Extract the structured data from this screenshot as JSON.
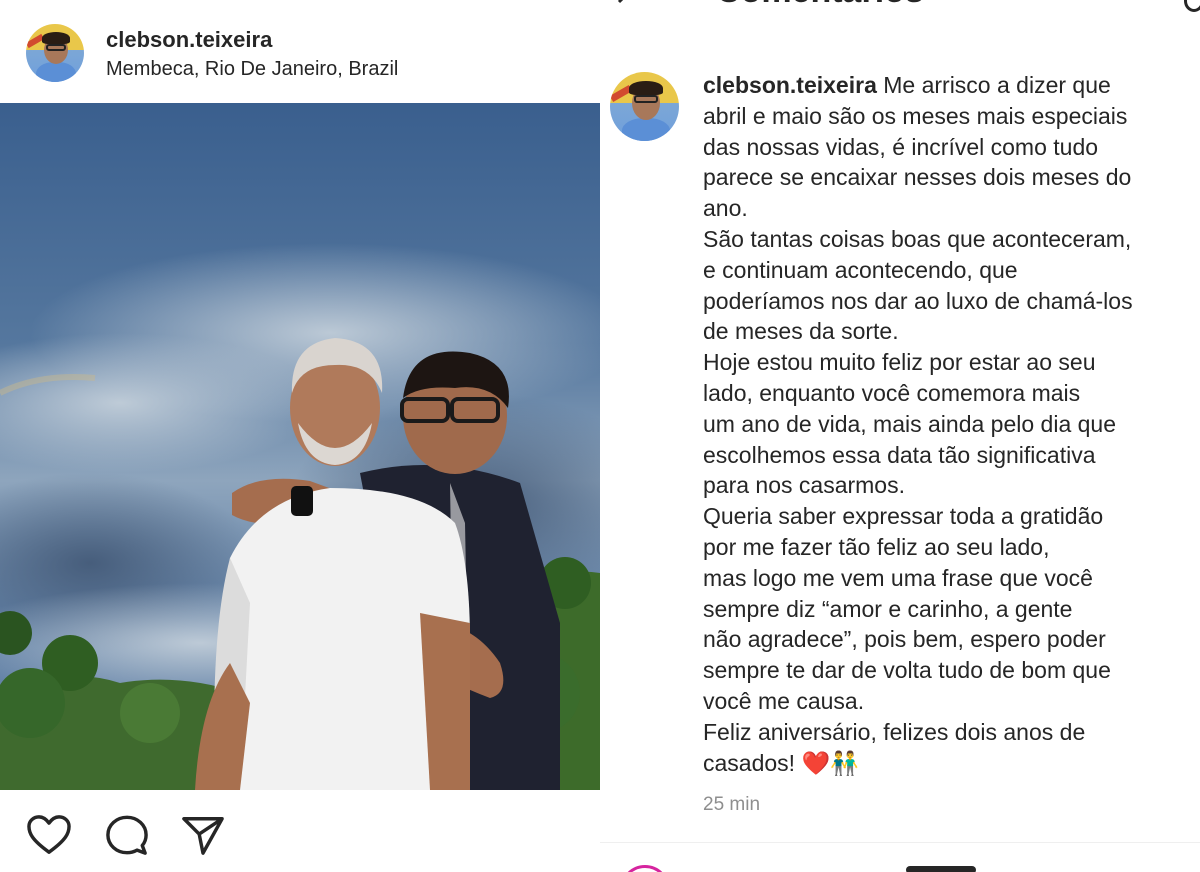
{
  "post": {
    "username": "clebson.teixeira",
    "location": "Membeca, Rio De Janeiro, Brazil"
  },
  "icons": {
    "actions": [
      "heart-icon",
      "comment-icon",
      "share-icon"
    ],
    "back": "arrow-left-icon"
  },
  "comments_panel": {
    "title": "Comentários",
    "comment": {
      "username": "clebson.teixeira",
      "lines": [
        "Me arrisco a dizer que",
        "abril e maio são os meses mais especiais",
        "das nossas vidas, é incrível como tudo",
        "parece se encaixar nesses dois meses do",
        "ano.",
        "São tantas coisas boas que aconteceram,",
        "e continuam acontecendo, que",
        "poderíamos nos dar ao luxo de chamá-los",
        "de meses da sorte.",
        "Hoje estou muito feliz por estar ao seu",
        "lado, enquanto você comemora mais",
        "um ano de vida, mais ainda pelo dia que",
        "escolhemos essa data tão significativa",
        "para nos casarmos.",
        "Queria saber expressar toda a gratidão",
        "por me fazer tão feliz ao seu lado,",
        "mas logo me vem uma frase que você",
        "sempre diz “amor e carinho, a gente",
        "não agradece”, pois bem, espero poder",
        "sempre te dar de volta tudo de bom que",
        "você me causa.",
        "Feliz aniversário, felizes dois anos de",
        "casados!"
      ],
      "emoji_heart": "❤️",
      "emoji_couple": "👬",
      "time": "25 min"
    }
  },
  "colors": {
    "text": "#262626",
    "muted": "#8e8e8e",
    "heart": "#e0192e"
  }
}
